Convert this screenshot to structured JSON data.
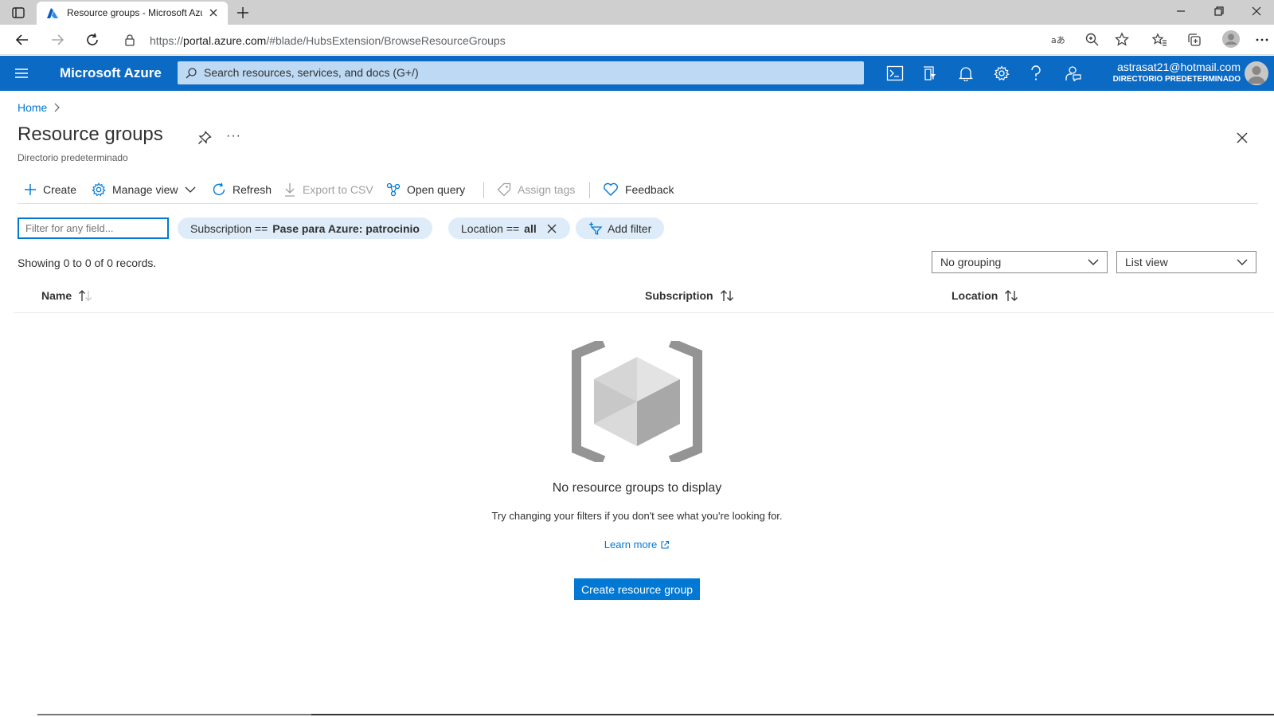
{
  "browser": {
    "tab_title": "Resource groups - Microsoft Azure",
    "url_prefix": "https://",
    "url_host": "portal.azure.com",
    "url_path": "/#blade/HubsExtension/BrowseResourceGroups"
  },
  "azure_header": {
    "brand": "Microsoft Azure",
    "search_placeholder": "Search resources, services, and docs (G+/)",
    "account_email": "astrasat21@hotmail.com",
    "account_directory": "DIRECTORIO PREDETERMINADO",
    "accent_color": "#0b6ac4"
  },
  "breadcrumb": {
    "home": "Home"
  },
  "page": {
    "title": "Resource groups",
    "more": "···",
    "subtitle": "Directorio predeterminado"
  },
  "toolbar": {
    "create": "Create",
    "manage_view": "Manage view",
    "refresh": "Refresh",
    "export_csv": "Export to CSV",
    "open_query": "Open query",
    "assign_tags": "Assign tags",
    "feedback": "Feedback"
  },
  "filters": {
    "filter_placeholder": "Filter for any field...",
    "subscription_label": "Subscription ==",
    "subscription_value": "Pase para Azure: patrocinio",
    "location_label": "Location ==",
    "location_value": "all",
    "add_filter": "Add filter"
  },
  "list": {
    "records_text": "Showing 0 to 0 of 0 records.",
    "grouping": "No grouping",
    "view": "List view",
    "columns": [
      "Name",
      "Subscription",
      "Location"
    ]
  },
  "empty_state": {
    "title": "No resource groups to display",
    "subtitle": "Try changing your filters if you don't see what you're looking for.",
    "learn_more": "Learn more",
    "create_button": "Create resource group"
  }
}
